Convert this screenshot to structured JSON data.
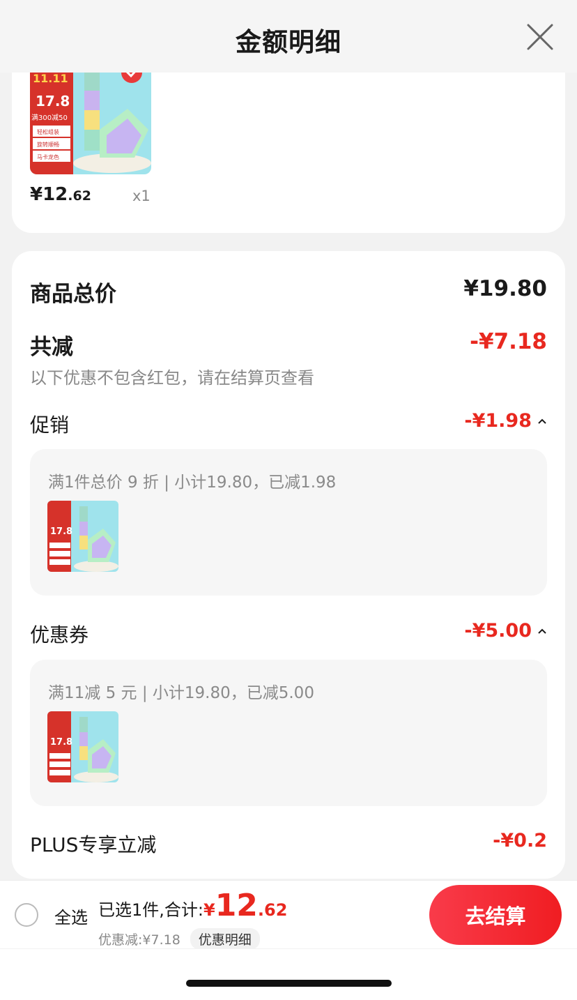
{
  "header": {
    "title": "金额明细"
  },
  "product": {
    "price_int": "¥12",
    "price_cents": ".62",
    "quantity": "x1",
    "thumb_price": "17.8",
    "thumb_promo": "满300减50",
    "thumb_features": [
      "轻松组装",
      "旋转顺畅",
      "马卡龙色"
    ]
  },
  "summary": {
    "goods_total_label": "商品总价",
    "goods_total_value": "¥19.80",
    "total_reduction_label": "共减",
    "total_reduction_value": "-¥7.18",
    "note": "以下优惠不包含红包，请在结算页查看"
  },
  "promotion": {
    "label": "促销",
    "value": "-¥1.98",
    "detail": "满1件总价 9 折 | 小计19.80，已减1.98"
  },
  "coupon": {
    "label": "优惠券",
    "value": "-¥5.00",
    "detail": "满11减 5 元 | 小计19.80，已减5.00"
  },
  "plus": {
    "label": "PLUS专享立减",
    "value": "-¥0.2"
  },
  "bottom_bar": {
    "select_all": "全选",
    "selected_text": "已选1件,合计:",
    "total_symbol": "¥",
    "total_int": "12",
    "total_cents": ".62",
    "discount_text": "优惠减:¥7.18",
    "detail_chip": "优惠明细",
    "checkout": "去结算"
  },
  "colors": {
    "accent_red": "#e8281f",
    "checkout_gradient_start": "#f93b4a",
    "checkout_gradient_end": "#f01d22"
  }
}
